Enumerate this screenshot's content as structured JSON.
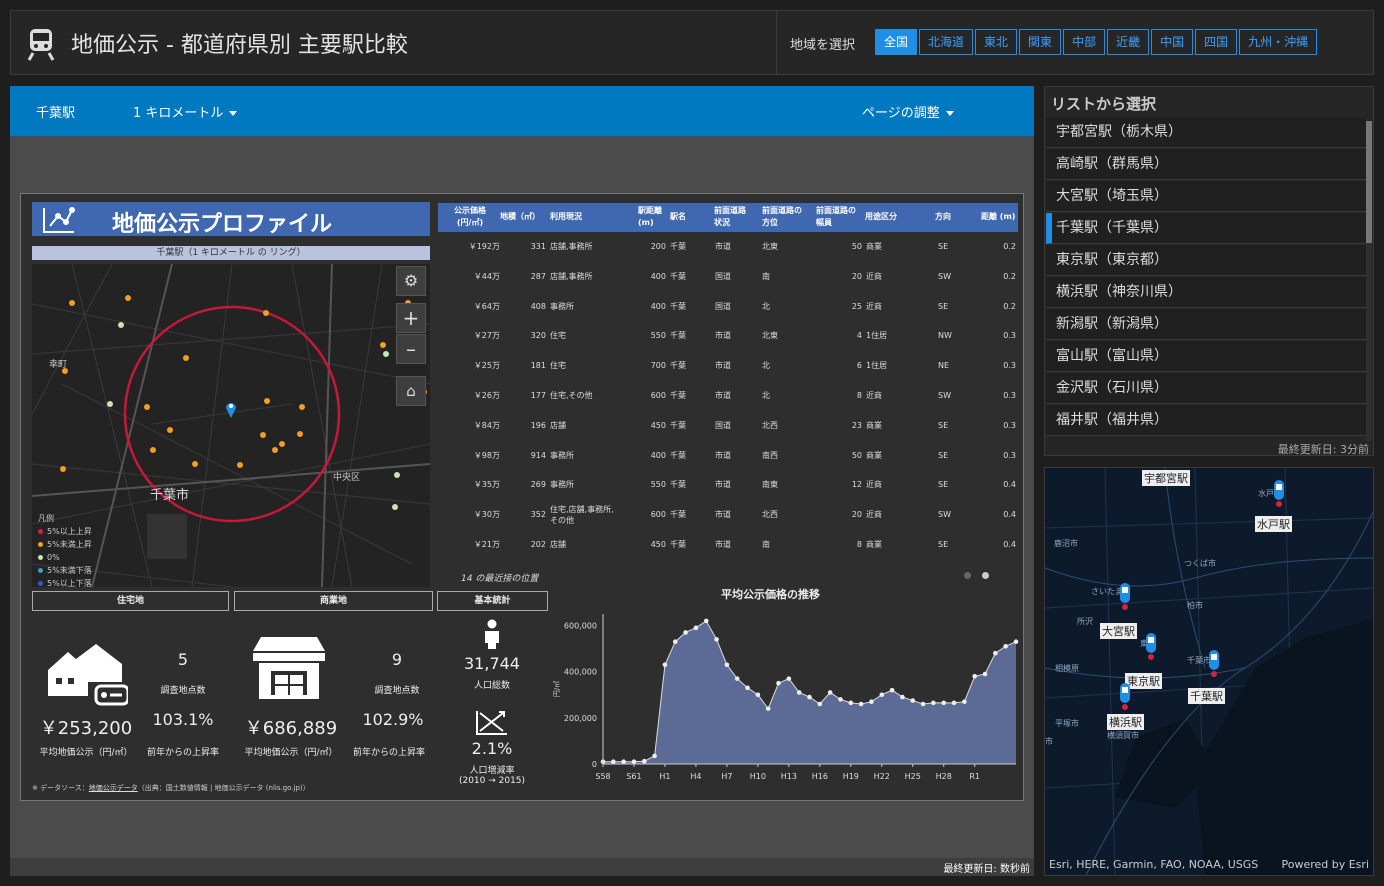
{
  "header": {
    "title": "地価公示 - 都道府県別 主要駅比較",
    "region_label": "地域を選択",
    "regions": [
      "全国",
      "北海道",
      "東北",
      "関東",
      "中部",
      "近畿",
      "中国",
      "四国",
      "九州・沖縄"
    ]
  },
  "toolbar": {
    "station": "千葉駅",
    "distance": "1 キロメートル",
    "page_adjust": "ページの調整"
  },
  "profile": {
    "title": "地価公示プロファイル",
    "subtitle": "千葉駅（1 キロメートル の リング）",
    "map_labels": {
      "town": "幸町",
      "city": "千葉市",
      "ward": "中央区"
    },
    "legend": {
      "title": "凡例",
      "items": [
        "5%以上上昇",
        "5%未満上昇",
        "0%",
        "5%未満下落",
        "5%以上下落"
      ],
      "colors": [
        "#d2233f",
        "#f59d24",
        "#c8e6b4",
        "#3aa0c8",
        "#2f5ebd"
      ]
    },
    "nearest_note": "14 の最近接の位置",
    "tabs": [
      "住宅地",
      "商業地",
      "基本統計"
    ],
    "stats": {
      "residential_count": "5",
      "residential_count_label": "調査地点数",
      "residential_avg": "￥253,200",
      "residential_avg_label": "平均地価公示（円/㎡）",
      "residential_rate": "103.1%",
      "residential_rate_label": "前年からの上昇率",
      "commercial_count": "9",
      "commercial_count_label": "調査地点数",
      "commercial_avg": "￥686,889",
      "commercial_avg_label": "平均地価公示（円/㎡）",
      "commercial_rate": "102.9%",
      "commercial_rate_label": "前年からの上昇率",
      "population": "31,744",
      "population_label": "人口総数",
      "pop_growth": "2.1%",
      "pop_growth_label": "人口増減率",
      "pop_growth_period": "(2010 → 2015)"
    },
    "source": "※ データソース：",
    "source_link": "地価公示データ",
    "source_note": "（出典：国土数値情報 | 地価公示データ (nlis.go.jp)）"
  },
  "table": {
    "headers": [
      "公示価格\n(円/㎡)",
      "地積（㎡）",
      "利用現況",
      "駅距離\n(m)",
      "駅名",
      "前面道路\n状況",
      "前面道路の\n方位",
      "前面道路の\n幅員",
      "用途区分",
      "方向",
      "距離 (m)"
    ],
    "rows": [
      [
        "￥192万",
        "331",
        "店舗,事務所",
        "200",
        "千葉",
        "市道",
        "北東",
        "50",
        "商業",
        "SE",
        "0.2"
      ],
      [
        "￥44万",
        "287",
        "店舗,事務所",
        "400",
        "千葉",
        "国道",
        "南",
        "20",
        "近商",
        "SW",
        "0.2"
      ],
      [
        "￥64万",
        "408",
        "事務所",
        "400",
        "千葉",
        "国道",
        "北",
        "25",
        "近商",
        "SE",
        "0.2"
      ],
      [
        "￥27万",
        "320",
        "住宅",
        "550",
        "千葉",
        "市道",
        "北東",
        "4",
        "1住居",
        "NW",
        "0.3"
      ],
      [
        "￥25万",
        "181",
        "住宅",
        "700",
        "千葉",
        "市道",
        "北",
        "6",
        "1住居",
        "NE",
        "0.3"
      ],
      [
        "￥26万",
        "177",
        "住宅,その他",
        "600",
        "千葉",
        "市道",
        "北",
        "8",
        "近商",
        "SW",
        "0.3"
      ],
      [
        "￥84万",
        "196",
        "店舗",
        "450",
        "千葉",
        "国道",
        "北西",
        "23",
        "商業",
        "SE",
        "0.3"
      ],
      [
        "￥98万",
        "914",
        "事務所",
        "400",
        "千葉",
        "市道",
        "南西",
        "50",
        "商業",
        "SE",
        "0.3"
      ],
      [
        "￥35万",
        "269",
        "事務所",
        "550",
        "千葉",
        "市道",
        "南東",
        "12",
        "近商",
        "SE",
        "0.4"
      ],
      [
        "￥30万",
        "352",
        "住宅,店舗,事務所,\nその他",
        "600",
        "千葉",
        "市道",
        "北西",
        "20",
        "近商",
        "SW",
        "0.4"
      ],
      [
        "￥21万",
        "202",
        "店舗",
        "450",
        "千葉",
        "市道",
        "南",
        "8",
        "商業",
        "SE",
        "0.4"
      ]
    ]
  },
  "chart_data": {
    "type": "area",
    "title": "平均公示価格の推移",
    "ylabel": "円/㎡",
    "ylim": [
      0,
      650000
    ],
    "yticks": [
      "0",
      "200,000",
      "400,000",
      "600,000"
    ],
    "xticks": [
      "S58",
      "S61",
      "H1",
      "H4",
      "H7",
      "H10",
      "H13",
      "H16",
      "H19",
      "H22",
      "H25",
      "H28",
      "R1"
    ],
    "values": [
      10000,
      10000,
      10000,
      10000,
      12000,
      35000,
      430000,
      530000,
      570000,
      590000,
      620000,
      540000,
      430000,
      370000,
      330000,
      300000,
      240000,
      350000,
      370000,
      310000,
      290000,
      260000,
      310000,
      280000,
      265000,
      260000,
      270000,
      300000,
      320000,
      290000,
      275000,
      260000,
      265000,
      265000,
      265000,
      270000,
      380000,
      390000,
      480000,
      510000,
      530000
    ]
  },
  "sidebar": {
    "title": "リストから選択",
    "items": [
      "宇都宮駅（栃木県）",
      "高崎駅（群馬県）",
      "大宮駅（埼玉県）",
      "千葉駅（千葉県）",
      "東京駅（東京都）",
      "横浜駅（神奈川県）",
      "新潟駅（新潟県）",
      "富山駅（富山県）",
      "金沢駅（石川県）",
      "福井駅（福井県）"
    ],
    "updated": "最終更新日: 3分前"
  },
  "overview": {
    "labels": [
      "宇都宮駅",
      "水戸駅",
      "大宮駅",
      "東京駅",
      "千葉駅",
      "横浜駅"
    ],
    "attribution": "Esri, HERE, Garmin, FAO, NOAA, USGS",
    "powered": "Powered by Esri",
    "places": [
      "水戸",
      "鹿沼市",
      "つくば市",
      "さいたま市",
      "柏市",
      "所沢",
      "東京",
      "千葉市",
      "相模原",
      "平塚市",
      "横須賀市",
      "市"
    ]
  },
  "footer": {
    "updated": "最終更新日: 数秒前"
  }
}
